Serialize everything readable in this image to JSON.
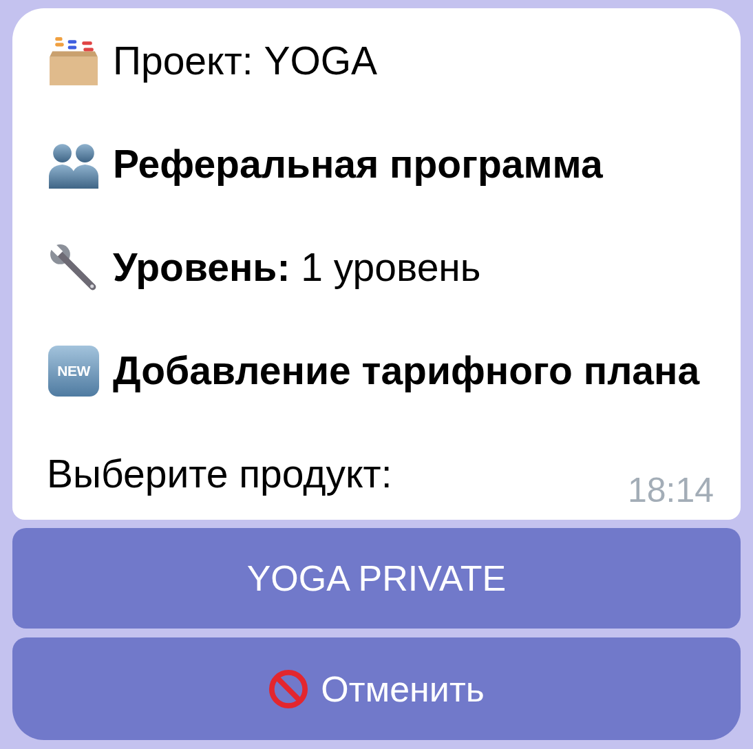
{
  "message": {
    "lines": [
      {
        "text": "Проект: YOGA",
        "bold": false
      },
      {
        "text": "Реферальная программа",
        "bold": true
      },
      {
        "text": "**Уровень:** 1 уровень",
        "bold": false
      },
      {
        "text": "Добавление тарифного плана",
        "bold": true,
        "badge": "NEW"
      }
    ],
    "prompt": "Выберите продукт:",
    "time": "18:14"
  },
  "keyboard": [
    {
      "label": "YOGA PRIVATE",
      "kind": "option"
    },
    {
      "label": "Отменить",
      "kind": "cancel"
    }
  ]
}
